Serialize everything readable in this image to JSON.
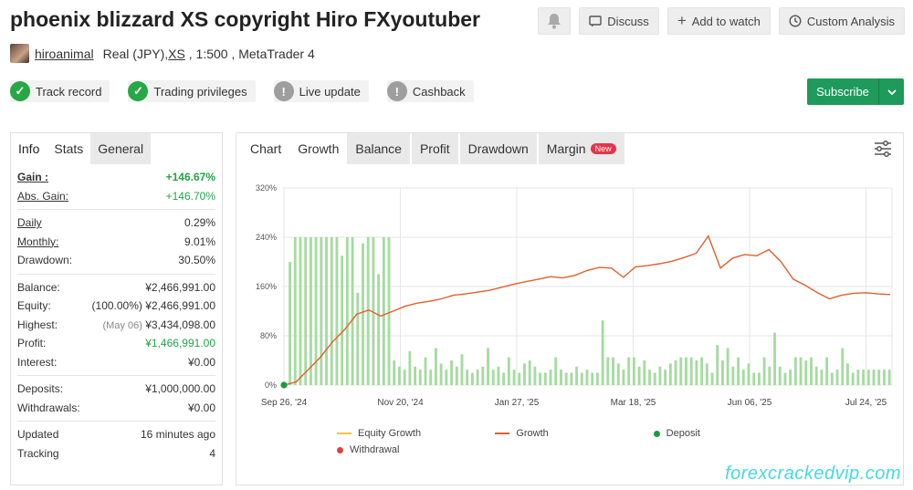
{
  "header": {
    "title": "phoenix blizzard XS copyright Hiro FXyoutuber",
    "discuss_label": "Discuss",
    "watch_label": "Add to watch",
    "analysis_label": "Custom Analysis"
  },
  "account": {
    "username": "hiroanimal",
    "prefix": "Real (JPY), ",
    "leverage_link": "XS",
    "suffix": " , 1:500 , MetaTrader 4"
  },
  "badges": [
    {
      "label": "Track record",
      "status": "ok"
    },
    {
      "label": "Trading privileges",
      "status": "ok"
    },
    {
      "label": "Live update",
      "status": "no"
    },
    {
      "label": "Cashback",
      "status": "no"
    }
  ],
  "subscribe": {
    "label": "Subscribe"
  },
  "left_tabs": {
    "info": "Info",
    "stats": "Stats",
    "general": "General"
  },
  "stats": {
    "gain_k": "Gain :",
    "gain_v": "+146.67%",
    "abs_gain_k": "Abs. Gain:",
    "abs_gain_v": "+146.70%",
    "daily_k": "Daily",
    "daily_v": "0.29%",
    "monthly_k": "Monthly:",
    "monthly_v": "9.01%",
    "drawdown_k": "Drawdown:",
    "drawdown_v": "30.50%",
    "balance_k": "Balance:",
    "balance_v": "¥2,466,991.00",
    "equity_k": "Equity:",
    "equity_pct": "(100.00%)",
    "equity_v": "¥2,466,991.00",
    "highest_k": "Highest:",
    "highest_date": "(May 06)",
    "highest_v": "¥3,434,098.00",
    "profit_k": "Profit:",
    "profit_v": "¥1,466,991.00",
    "interest_k": "Interest:",
    "interest_v": "¥0.00",
    "deposits_k": "Deposits:",
    "deposits_v": "¥1,000,000.00",
    "withdrawals_k": "Withdrawals:",
    "withdrawals_v": "¥0.00",
    "updated_k": "Updated",
    "updated_v": "16 minutes ago",
    "tracking_k": "Tracking",
    "tracking_v": "4"
  },
  "chart_tabs": {
    "chart": "Chart",
    "growth": "Growth",
    "balance": "Balance",
    "profit": "Profit",
    "drawdown": "Drawdown",
    "margin": "Margin",
    "new": "New"
  },
  "legend": {
    "equity_growth": "Equity Growth",
    "growth": "Growth",
    "deposit": "Deposit",
    "withdrawal": "Withdrawal"
  },
  "colors": {
    "growth": "#e0602c",
    "equity": "#f2c63a",
    "bars": "#a5dba0",
    "deposit": "#1c9a3c",
    "withdrawal": "#e04040"
  },
  "chart_data": {
    "type": "line",
    "ylim": [
      0,
      320
    ],
    "yticks": [
      "0%",
      "80%",
      "160%",
      "240%",
      "320%"
    ],
    "xticks": [
      "Sep 26, '24",
      "Nov 20, '24",
      "Jan 27, '25",
      "Mar 18, '25",
      "Jun 06, '25",
      "Jul 24, '25"
    ],
    "series": [
      {
        "name": "Growth",
        "values": [
          0,
          5,
          25,
          45,
          70,
          90,
          115,
          122,
          112,
          120,
          128,
          133,
          136,
          140,
          146,
          148,
          151,
          154,
          159,
          164,
          168,
          172,
          176,
          174,
          178,
          186,
          191,
          190,
          175,
          192,
          194,
          197,
          201,
          207,
          214,
          242,
          190,
          206,
          212,
          210,
          220,
          200,
          172,
          162,
          150,
          140,
          146,
          149,
          150,
          148,
          147
        ]
      },
      {
        "name": "Equity Growth",
        "values": [
          0,
          5,
          25,
          45,
          70,
          90,
          115,
          122,
          112,
          120,
          128,
          133,
          136,
          140,
          146,
          148,
          151,
          154,
          159,
          164,
          168,
          172,
          176,
          174,
          178,
          186,
          191,
          190,
          175,
          192,
          194,
          197,
          201,
          207,
          214,
          242,
          190,
          206,
          212,
          210,
          220,
          200,
          172,
          162,
          150,
          140,
          146,
          149,
          150,
          148,
          147
        ]
      }
    ],
    "bars": [
      5,
      200,
      240,
      240,
      240,
      240,
      240,
      240,
      240,
      240,
      240,
      210,
      240,
      240,
      150,
      230,
      240,
      240,
      180,
      240,
      240,
      40,
      30,
      25,
      55,
      30,
      25,
      45,
      25,
      60,
      35,
      25,
      40,
      30,
      50,
      25,
      20,
      25,
      30,
      60,
      25,
      30,
      20,
      45,
      25,
      20,
      35,
      40,
      30,
      20,
      20,
      25,
      45,
      25,
      20,
      20,
      30,
      20,
      25,
      20,
      20,
      105,
      45,
      45,
      35,
      25,
      45,
      45,
      30,
      40,
      25,
      20,
      30,
      25,
      35,
      40,
      45,
      45,
      45,
      40,
      45,
      35,
      20,
      65,
      40,
      60,
      30,
      45,
      25,
      35,
      20,
      20,
      45,
      30,
      85,
      30,
      20,
      25,
      45,
      45,
      40,
      45,
      30,
      25,
      45,
      20,
      25,
      60,
      35,
      20,
      25,
      25,
      25,
      25,
      25,
      25,
      25
    ],
    "deposit_markers": [
      0
    ]
  }
}
